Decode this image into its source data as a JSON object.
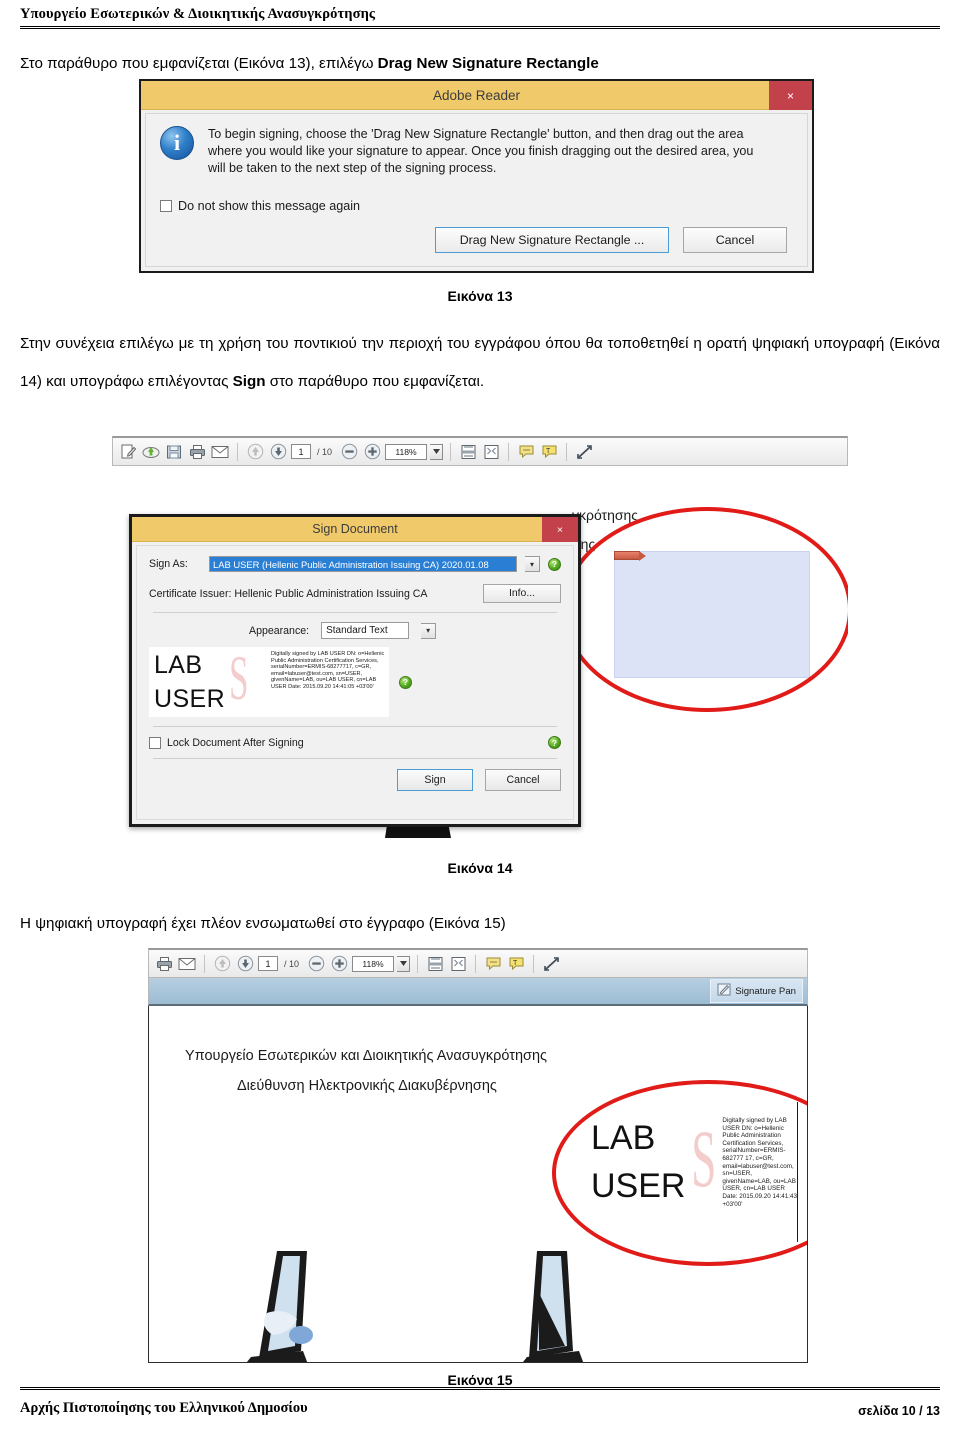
{
  "header": {
    "title": "Υπουργείο Εσωτερικών & Διοικητικής Ανασυγκρότησης"
  },
  "paragraphs": {
    "p1_before": "Στο παράθυρο που εμφανίζεται (Εικόνα 13), επιλέγω ",
    "p1_bold": "Drag New Signature Rectangle",
    "p2_a": "Στην συνέχεια επιλέγω με τη χρήση του ποντικιού την περιοχή του εγγράφου όπου θα τοποθετηθεί η ορατή ψηφιακή υπογραφή (Εικόνα 14) και υπογράφω επιλέγοντας ",
    "p2_bold": "Sign",
    "p2_b": " στο παράθυρο που εμφανίζεται.",
    "p3": "Η ψηφιακή υπογραφή έχει πλέον ενσωματωθεί στο έγγραφο (Εικόνα 15)"
  },
  "captions": {
    "fig13": "Εικόνα 13",
    "fig14": "Εικόνα 14",
    "fig15": "Εικόνα 15"
  },
  "figure13": {
    "title": "Adobe Reader",
    "close_label": "×",
    "message": "To begin signing, choose the 'Drag New Signature Rectangle' button, and then drag out the area where you would like your signature to appear. Once you finish dragging out the desired area, you will be taken to the next step of the signing process.",
    "checkbox_label": "Do not show this message again",
    "primary_button": "Drag New Signature Rectangle ...",
    "cancel_button": "Cancel",
    "titlebar_color": "#f0c96a",
    "close_color": "#c3414a"
  },
  "pdf_toolbar": {
    "page_value": "1",
    "page_total": "/ 10",
    "zoom_value": "118%",
    "icons": [
      "sign-pen-icon",
      "cloud-upload-icon",
      "save-icon",
      "print-icon",
      "email-icon",
      "page-up-icon",
      "page-down-icon",
      "zoom-out-icon",
      "zoom-in-icon",
      "page-fit-icon",
      "page-view-icon",
      "comment-icon",
      "highlight-text-icon",
      "fullscreen-icon"
    ]
  },
  "figure14": {
    "dialog": {
      "title": "Sign Document",
      "close_label": "×",
      "sign_as_label": "Sign As:",
      "sign_as_value": "LAB USER (Hellenic Public Administration Issuing CA) 2020.01.08",
      "certificate_issuer": "Certificate Issuer: Hellenic Public Administration Issuing CA",
      "info_button": "Info...",
      "appearance_label": "Appearance:",
      "appearance_value": "Standard Text",
      "signature_name": "LAB USER",
      "signature_details": "Digitally signed by LAB USER DN: o=Hellenic Public Administration Certification Services, serialNumber=ERMIS-68277717, c=GR, email=labuser@test.com, sn=USER, givenName=LAB, ou=LAB USER, cn=LAB USER Date: 2015.09.20 14:41:05 +03'00'",
      "lock_checkbox_label": "Lock Document After Signing",
      "sign_button": "Sign",
      "cancel_button": "Cancel"
    },
    "document_text_line1": "γκρότησης",
    "document_text_line2": "σης",
    "annotation": "red-ellipse-highlight"
  },
  "figure15": {
    "signature_panel_label": "Signature Pan",
    "signature_panel_icon": "signature-panel-icon",
    "document_line1": "Υπουργείο Εσωτερικών και Διοικητικής Ανασυγκρότησης",
    "document_line2": "Διεύθυνση Ηλεκτρονικής Διακυβέρνησης",
    "signature_name": "LAB USER",
    "signature_details": "Digitally signed by LAB USER DN: o=Hellenic Public Administration Certification Services, serialNumber=ERMIS-682777 17, c=GR, email=labuser@test.com, sn=USER, givenName=LAB, ou=LAB USER, cn=LAB USER Date: 2015.09.20 14:41:43 +03'00'",
    "annotation": "red-ellipse-highlight"
  },
  "footer": {
    "left": "Αρχής Πιστοποίησης του Ελληνικού Δημοσίου",
    "right": "σελίδα 10 / 13"
  },
  "colors": {
    "dialog_titlebar": "#f0c96a",
    "close_red": "#c3414a",
    "annotation_red": "#e01b18",
    "select_blue": "#2a7fd4",
    "sig_placeholder": "#dde3f7"
  }
}
